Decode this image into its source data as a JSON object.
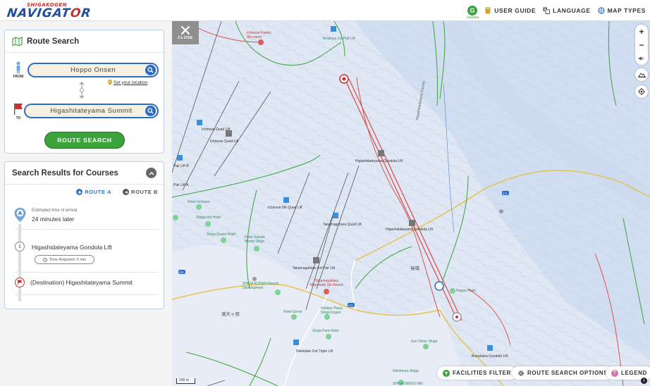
{
  "header": {
    "logo_small": "SHIGAKOGEN",
    "logo_big_1": "NAVIGAT",
    "logo_big_2": "O",
    "logo_big_3": "R",
    "green_badge": "G",
    "green_badge_sub": "GREEN",
    "nav": [
      "USER GUIDE",
      "LANGUAGE",
      "MAP TYPES"
    ]
  },
  "route_search": {
    "title": "Route Search",
    "from_label": "FROM",
    "to_label": "TO",
    "from_value": "Hoppo Onsen",
    "to_value": "Higashitateyama Summit",
    "set_location": "Set your location",
    "button": "ROUTE SEARCH"
  },
  "results": {
    "title": "Search Results for Courses",
    "tabs": [
      "ROUTE A",
      "ROUTE B"
    ],
    "eta_label": "Estimated time of arrival",
    "eta_value": "24 minutes later",
    "pin_letter": "A",
    "steps": [
      {
        "num": "1",
        "name": "Higashidateyama Gondola Lift",
        "time": "Time Required: 6 min"
      }
    ],
    "destination": "(Destination) Higashitateyama Summit"
  },
  "map": {
    "close_label": "CLOSE",
    "zoom_in": "+",
    "zoom_out": "−",
    "bottom_buttons": [
      "FACILITIES FILTER",
      "ROUTE SEARCH OPTIONS",
      "LEGEND"
    ],
    "scale": "100 m",
    "info": "i",
    "labels": {
      "ichinose_family": "Ichinose Family\nSki resort",
      "terakoya_2nd": "Terakoya 1st Pair Lift",
      "ichinose_quad": "Ichinose Quad Lift",
      "ichinose_quad2": "Ichinose Quad Lift",
      "gondola_top": "Higashidateyama Gondola Lift",
      "gondola_mid": "Higashidateyama Gondola Lift",
      "ichinose_6th": "Ichinose 6th Quad Lift",
      "takamagahara_quad": "Takamagahara Quad Lift",
      "takamagahara_3rd": "Takamagahara 3rd Pair Lift",
      "takamagahara_mammoth": "Takamagahara\nMammoth Ski Resort",
      "shiga_kogen_resort": "SHIGA KOGEN Resort\nDevelopment",
      "hotel_ginrei": "Hotel Ginrei",
      "holiday_plaza": "Holiday Plaza\nShiga Kogen",
      "shiga_park": "Shiga Park Hotel",
      "nishidate": "Nishidate 2nd Triple Lift",
      "sun_shine": "Sun Shine Shiga",
      "hotel_ichinose": "Hotel Ichinose",
      "shiga_ichi": "Shiga Ichi Hotel",
      "shiga_grand": "Shiga Grand Hotel",
      "hotel_sanset": "Hotel Sanset\nMonte Shiga",
      "shiga_swiss": "SHIGA SWISS INN",
      "bunadaira": "Bunadaira Gondola Lift",
      "pair_lift_b": "Pair Lift B",
      "pair_lift_a": "Pair Lift A",
      "hasshu": "発哺",
      "kanji_left": "蓮天ヶ原",
      "course": "Higashidateyama Course",
      "road_471": "471",
      "road_292": "292",
      "nishimu": "Nishimura Shiga",
      "hoppo_hotel": "Hoppo Hotel"
    }
  }
}
